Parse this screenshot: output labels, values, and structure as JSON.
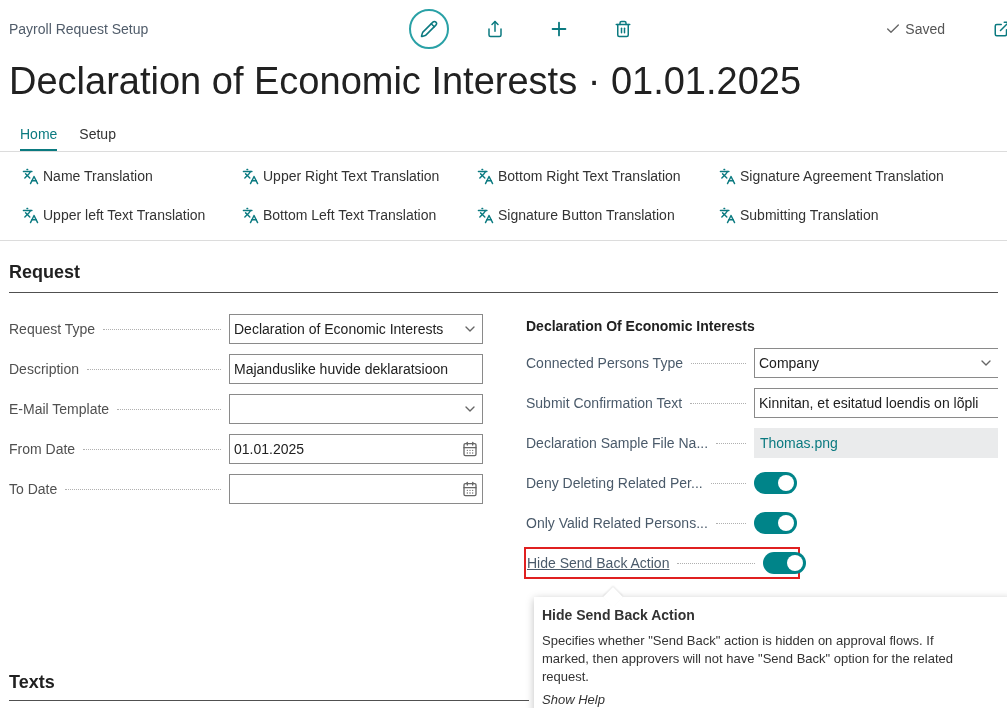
{
  "breadcrumb": "Payroll Request Setup",
  "status": "Saved",
  "title": "Declaration of Economic Interests · 01.01.2025",
  "tabs": [
    {
      "label": "Home",
      "selected": true
    },
    {
      "label": "Setup",
      "selected": false
    }
  ],
  "actions": [
    "Name Translation",
    "Upper Right Text Translation",
    "Bottom Right Text Translation",
    "Signature Agreement Translation",
    "Upper left Text Translation",
    "Bottom Left Text Translation",
    "Signature Button Translation",
    "Submitting Translation"
  ],
  "request": {
    "heading": "Request",
    "fields": [
      {
        "label": "Request Type",
        "kind": "dropdown",
        "value": "Declaration of Economic Interests"
      },
      {
        "label": "Description",
        "kind": "text",
        "value": "Majanduslike huvide deklaratsioon"
      },
      {
        "label": "E-Mail Template",
        "kind": "dropdown"
      },
      {
        "label": "From Date",
        "kind": "date",
        "value": "01.01.2025"
      },
      {
        "label": "To Date",
        "kind": "date"
      }
    ],
    "group_heading": "Declaration Of Economic Interests",
    "group_fields": [
      {
        "label": "Connected Persons Type",
        "kind": "dropdown",
        "value": "Company",
        "highlighted": false
      },
      {
        "label": "Submit Confirmation Text",
        "kind": "text",
        "value": "Kinnitan, et esitatud loendis on lõpli",
        "highlighted": false
      },
      {
        "label": "Declaration Sample File Na...",
        "kind": "link",
        "value": "Thomas.png",
        "highlighted": false
      },
      {
        "label": "Deny Deleting Related Per...",
        "kind": "toggle",
        "on": true,
        "highlighted": false
      },
      {
        "label": "Only Valid Related Persons...",
        "kind": "toggle",
        "on": true,
        "highlighted": false
      },
      {
        "label": "Hide Send Back Action",
        "kind": "toggle",
        "on": true,
        "highlighted": true
      }
    ]
  },
  "texts_heading": "Texts",
  "tooltip": {
    "title": "Hide Send Back Action",
    "body": "Specifies whether \"Send Back\" action is hidden on approval flows. If marked, then approvers will not have \"Send Back\" option for the related request.",
    "link": "Show Help"
  }
}
